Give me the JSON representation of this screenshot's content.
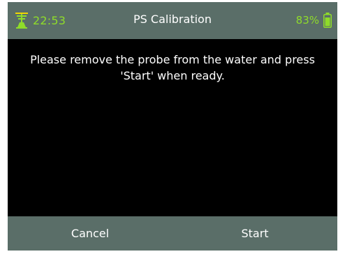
{
  "status_bar": {
    "time": "22:53",
    "title": "PS Calibration",
    "battery_percent": "83%",
    "battery_level": 0.83,
    "signal_icon": "antenna-icon",
    "battery_icon": "battery-icon"
  },
  "content": {
    "message": "Please remove the probe from the water and press 'Start' when ready."
  },
  "footer": {
    "cancel_label": "Cancel",
    "start_label": "Start"
  },
  "colors": {
    "bar_background": "#5a6e68",
    "accent_green": "#8fdc2a",
    "screen_background": "#000000",
    "text": "#ffffff"
  }
}
